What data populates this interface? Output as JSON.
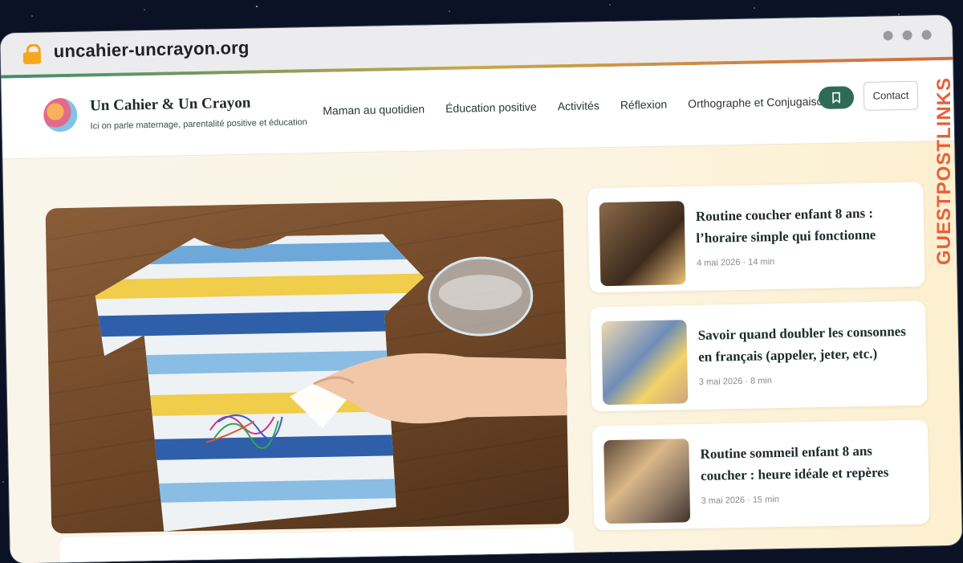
{
  "browser": {
    "url": "uncahier-uncrayon.org"
  },
  "site": {
    "title": "Un Cahier & Un Crayon",
    "tagline": "Ici on parle maternage, parentalité positive et éducation",
    "nav": [
      {
        "label": "Maman au quotidien"
      },
      {
        "label": "Éducation positive"
      },
      {
        "label": "Activités"
      },
      {
        "label": "Réflexion"
      },
      {
        "label": "Orthographe et Conjugaison"
      }
    ],
    "contact_label": "Contact",
    "accent_color": "#2e6b57"
  },
  "articles": [
    {
      "title": "Routine coucher enfant 8 ans : l’horaire simple qui fonctionne",
      "meta": "4 mai 2026 · 14 min"
    },
    {
      "title": "Savoir quand doubler les consonnes en français (appeler, jeter, etc.)",
      "meta": "3 mai 2026 · 8 min"
    },
    {
      "title": "Routine sommeil enfant 8 ans coucher : heure idéale et repères",
      "meta": "3 mai 2026 · 15 min"
    }
  ],
  "watermark": {
    "label": "GUESTPOSTLINKS"
  },
  "icons": {
    "lock": "lock-icon",
    "bookmark": "bookmark-icon"
  }
}
